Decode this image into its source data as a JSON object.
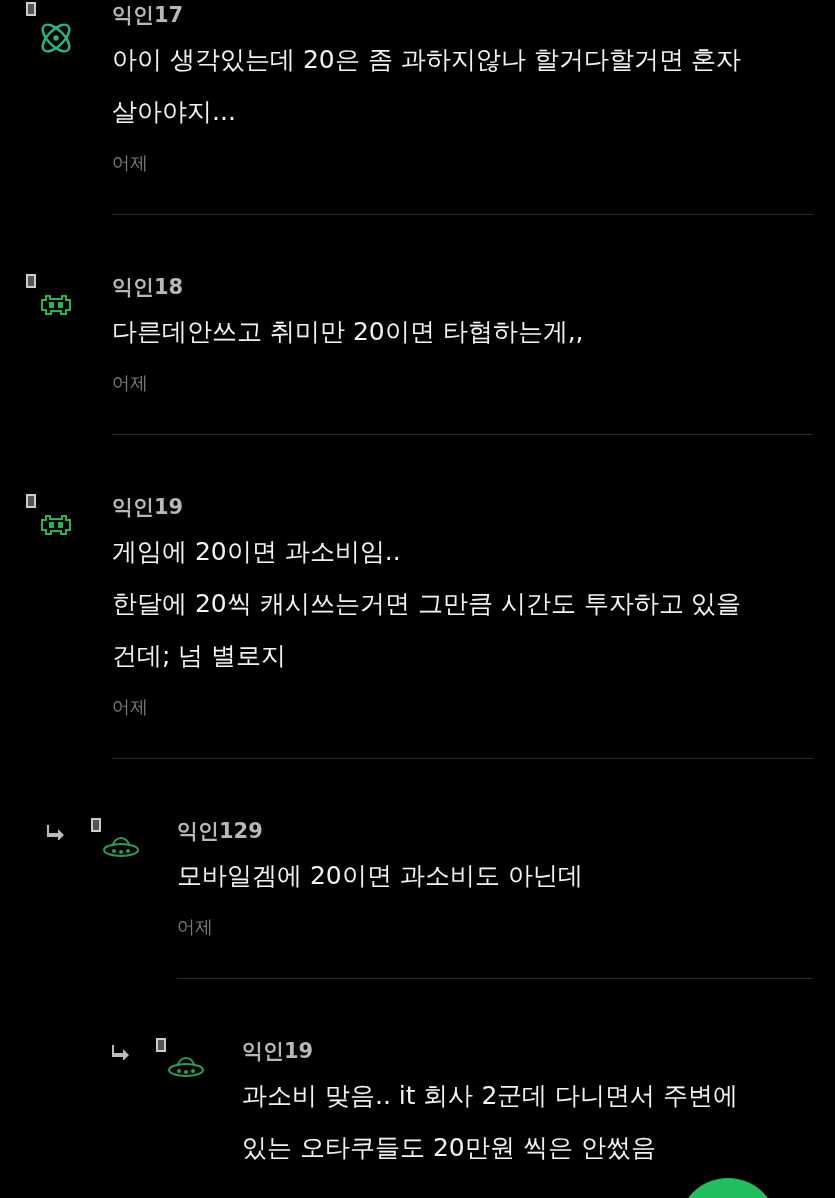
{
  "comments": [
    {
      "author": "익인17",
      "kind": "atom",
      "body": "아이 생각있는데 20은 좀 과하지않나 할거다할거면 혼자 살아야지...",
      "time": "어제"
    },
    {
      "author": "익인18",
      "kind": "invader",
      "body": "다른데안쓰고 취미만 20이면 타협하는게,,",
      "time": "어제"
    },
    {
      "author": "익인19",
      "kind": "invader",
      "body": "게임에 20이면 과소비임..\n한달에 20씩 캐시쓰는거면 그만큼 시간도 투자하고 있을 건데; 넘 별로지",
      "time": "어제",
      "children": [
        {
          "author": "익인129",
          "kind": "ufo",
          "body": "모바일겜에 20이면 과소비도 아닌데",
          "time": "어제",
          "children": [
            {
              "author": "익인19",
              "kind": "ufo",
              "body": "과소비 맞음.. it 회사 2군데 다니면서 주변에 있는 오타쿠들도 20만원 씩은 안썼음"
            }
          ]
        }
      ]
    }
  ]
}
